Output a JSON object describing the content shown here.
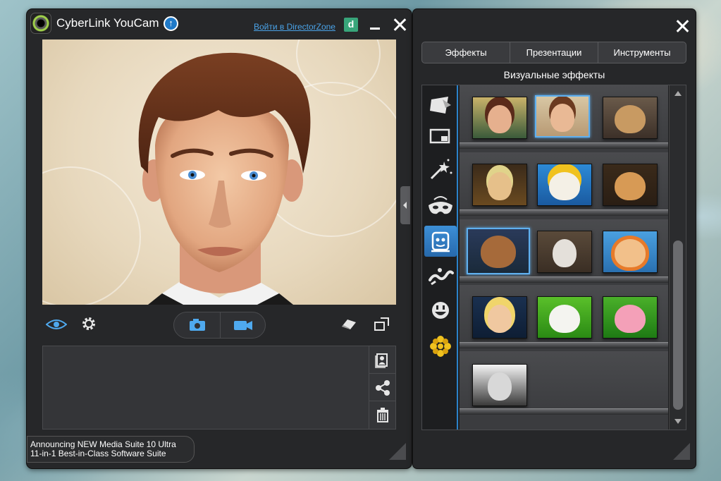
{
  "main_window": {
    "title": "CyberLink YouCam",
    "directorzone_link": "Войти в DirectorZone",
    "dz_icon_letter": "d",
    "announcement": {
      "line1": "Announcing NEW Media Suite 10 Ultra",
      "line2": "11-in-1 Best-in-Class Software Suite"
    }
  },
  "effects_panel": {
    "tabs": [
      "Эффекты",
      "Презентации",
      "Инструменты"
    ],
    "heading": "Визуальные эффекты",
    "categories": [
      "scene-icon",
      "frame-icon",
      "particle-wand-icon",
      "mask-icon",
      "avatar-icon",
      "distortion-icon",
      "emotion-icon",
      "gadget-icon"
    ],
    "active_category": 4
  },
  "colors": {
    "accent": "#2b82c9",
    "window_bg": "#262729",
    "selection_border": "#5fb0f0"
  }
}
